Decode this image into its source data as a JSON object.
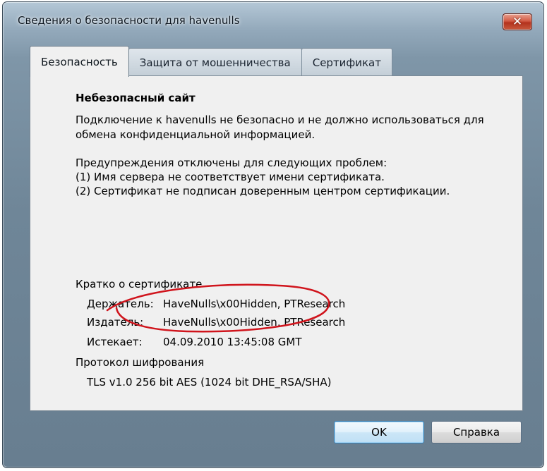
{
  "window": {
    "title": "Сведения о безопасности для havenulls",
    "close_symbol": "✕"
  },
  "tabs": [
    {
      "label": "Безопасность",
      "active": true
    },
    {
      "label": "Защита от мошенничества",
      "active": false
    },
    {
      "label": "Сертификат",
      "active": false
    }
  ],
  "security": {
    "heading": "Небезопасный сайт",
    "description_line1": "Подключение к havenulls не безопасно и не должно использоваться для",
    "description_line2": "обмена конфиденциальной информацией.",
    "warnings_intro": "Предупреждения отключены для следующих проблем:",
    "warning1": "(1) Имя сервера не соответствует имени сертификата.",
    "warning2": "(2) Сертификат не подписан доверенным центром сертификации."
  },
  "certificate_summary": {
    "heading": "Кратко о сертификате",
    "holder_label": "Держатель:",
    "holder_value": "HaveNulls\\x00Hidden, PTResearch",
    "issuer_label": "Издатель:",
    "issuer_value": "HaveNulls\\x00Hidden, PTResearch",
    "expires_label": "Истекает:",
    "expires_value": "04.09.2010 13:45:08 GMT"
  },
  "protocol": {
    "heading": "Протокол шифрования",
    "value": "TLS v1.0 256 bit AES (1024 bit DHE_RSA/SHA)"
  },
  "buttons": {
    "ok": "OK",
    "help": "Справка"
  },
  "colors": {
    "annotation": "#d0141c",
    "default_button_border": "#3c7fb1"
  }
}
